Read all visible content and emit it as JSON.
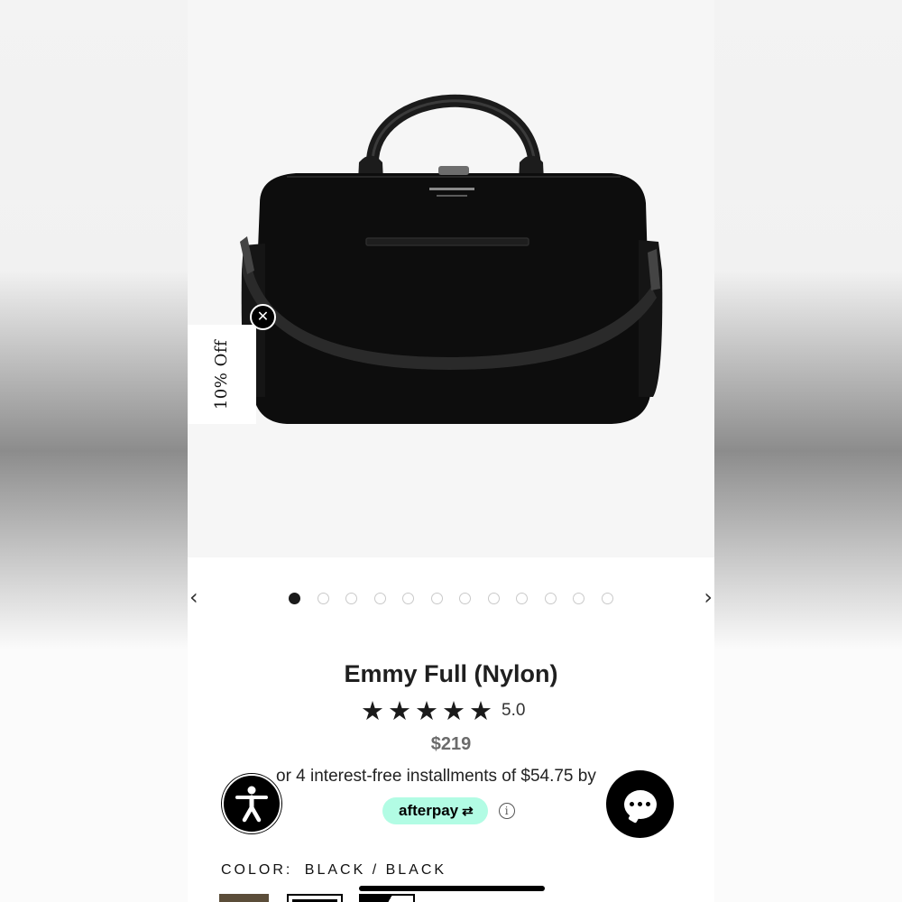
{
  "promo": {
    "label": "10% Off",
    "close_icon": "close-icon"
  },
  "carousel": {
    "prev_icon": "chevron-left-icon",
    "next_icon": "chevron-right-icon",
    "prev_glyph": "‹",
    "next_glyph": "›",
    "total_slides": 12,
    "active_slide": 1
  },
  "product": {
    "title": "Emmy Full (Nylon)",
    "rating_stars": 5,
    "star_glyph": "★",
    "rating_value": "5.0",
    "price": "$219",
    "installments_text": "or 4 interest-free installments of $54.75 by",
    "afterpay_label": "afterpay",
    "afterpay_mark": "⇄",
    "info_glyph": "i",
    "color_label": "COLOR:",
    "color_value": "BLACK / BLACK"
  },
  "widgets": {
    "accessibility_icon": "accessibility-icon",
    "chat_icon": "chat-icon"
  },
  "colors": {
    "afterpay_mint": "#b2fce4",
    "swatch_brown": "#5b4d39",
    "price_gray": "#6b6b6b"
  }
}
